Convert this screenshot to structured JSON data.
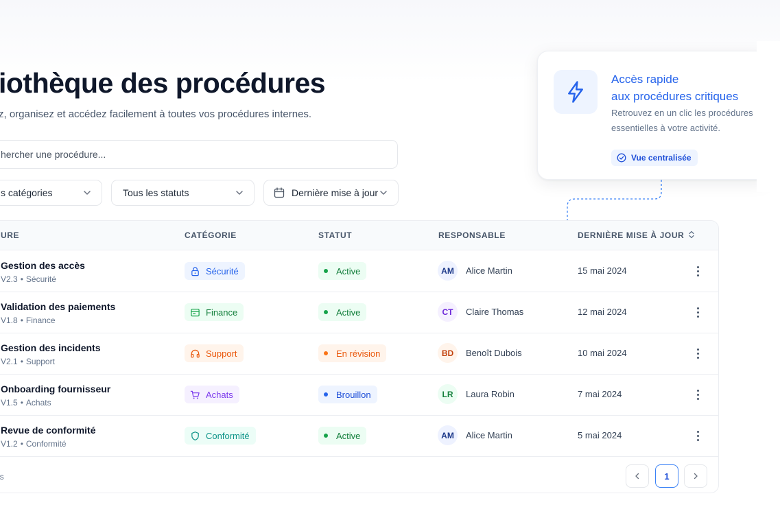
{
  "page": {
    "title": "iothèque des procédures",
    "subtitle": "z, organisez et accédez facilement à toutes vos procédures internes."
  },
  "search": {
    "placeholder": "hercher une procédure...",
    "icon": "search-icon"
  },
  "filters": {
    "category": "s catégories",
    "status": "Tous les statuts",
    "date": "Dernière mise à jour"
  },
  "quick_access": {
    "title_line1": "Accès rapide",
    "title_line2": "aux procédures critiques",
    "description": "Retrouvez en un clic les procédures essentielles à votre activité.",
    "badge": "Vue centralisée",
    "icon": "lightning-icon"
  },
  "table": {
    "headers": {
      "procedure": "URE",
      "category": "CATÉGORIE",
      "status": "STATUT",
      "owner": "RESPONSABLE",
      "updated": "DERNIÈRE MISE À JOUR"
    },
    "rows": [
      {
        "name": "Gestion des accès",
        "version": "V2.3",
        "meta_category": "Sécurité",
        "category": "Sécurité",
        "category_icon": "lock-icon",
        "status": "Active",
        "initials": "AM",
        "owner": "Alice Martin",
        "date": "15 mai 2024"
      },
      {
        "name": "Validation des paiements",
        "version": "V1.8",
        "meta_category": "Finance",
        "category": "Finance",
        "category_icon": "wallet-icon",
        "status": "Active",
        "initials": "CT",
        "owner": "Claire Thomas",
        "date": "12 mai 2024"
      },
      {
        "name": "Gestion des incidents",
        "version": "V2.1",
        "meta_category": "Support",
        "category": "Support",
        "category_icon": "headset-icon",
        "status": "En révision",
        "initials": "BD",
        "owner": "Benoît Dubois",
        "date": "10 mai 2024"
      },
      {
        "name": "Onboarding fournisseur",
        "version": "V1.5",
        "meta_category": "Achats",
        "category": "Achats",
        "category_icon": "cart-icon",
        "status": "Brouillon",
        "initials": "LR",
        "owner": "Laura Robin",
        "date": "7 mai 2024"
      },
      {
        "name": "Revue de conformité",
        "version": "V1.2",
        "meta_category": "Conformité",
        "category": "Conformité",
        "category_icon": "shield-icon",
        "status": "Active",
        "initials": "AM",
        "owner": "Alice Martin",
        "date": "5 mai 2024"
      }
    ],
    "footer_text": "res",
    "pagination": {
      "current": "1"
    }
  },
  "colors": {
    "accent": "#2563eb",
    "security": "#2563eb",
    "finance": "#16a34a",
    "support": "#ea580c",
    "purchasing": "#7c3aed",
    "compliance": "#0d9488",
    "status_active": "#15803d",
    "status_review": "#ea580c",
    "status_draft": "#1d4ed8"
  }
}
